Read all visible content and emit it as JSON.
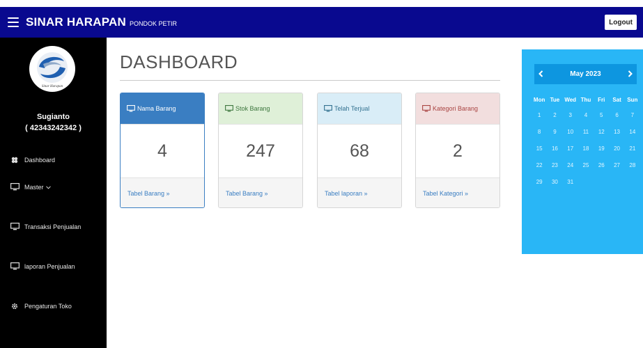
{
  "topbar": {
    "brand": "SINAR HARAPAN",
    "subtitle": "PONDOK PETIR",
    "logout_label": "Logout",
    "color": "#09098f"
  },
  "sidebar": {
    "logo_text": "Sinar Harapan",
    "user_name": "Sugianto",
    "user_id": "( 42343242342 )",
    "items": [
      {
        "label": "Dashboard",
        "icon": "dashboard-icon"
      },
      {
        "label": "Master",
        "icon": "monitor-icon",
        "has_dropdown": true
      },
      {
        "label": "Transaksi Penjualan",
        "icon": "monitor-icon"
      },
      {
        "label": "laporan Penjualan",
        "icon": "monitor-icon"
      },
      {
        "label": "Pengaturan Toko",
        "icon": "gear-icon"
      }
    ]
  },
  "main": {
    "title": "DASHBOARD",
    "cards": [
      {
        "title": "Nama Barang",
        "value": "4",
        "link": "Tabel Barang »",
        "theme": "blue"
      },
      {
        "title": "Stok Barang",
        "value": "247",
        "link": "Tabel Barang »",
        "theme": "green"
      },
      {
        "title": "Telah Terjual",
        "value": "68",
        "link": "Tabel laporan »",
        "theme": "lightblue"
      },
      {
        "title": "Kategori Barang",
        "value": "2",
        "link": "Tabel Kategori »",
        "theme": "red"
      }
    ]
  },
  "calendar": {
    "month_label": "May 2023",
    "prev": "‹",
    "next": "›",
    "weekdays": [
      "Mon",
      "Tue",
      "Wed",
      "Thu",
      "Fri",
      "Sat",
      "Sun"
    ],
    "weeks": [
      [
        "1",
        "2",
        "3",
        "4",
        "5",
        "6",
        "7"
      ],
      [
        "8",
        "9",
        "10",
        "11",
        "12",
        "13",
        "14"
      ],
      [
        "15",
        "16",
        "17",
        "18",
        "19",
        "20",
        "21"
      ],
      [
        "22",
        "23",
        "24",
        "25",
        "26",
        "27",
        "28"
      ],
      [
        "29",
        "30",
        "31",
        "",
        "",
        "",
        ""
      ]
    ],
    "color": "#29b6f6"
  },
  "colors": {
    "blue_head": "#3a7ec2",
    "green_head": "#dff0d8",
    "lightblue_head": "#d9edf7",
    "red_head": "#f2dede"
  }
}
